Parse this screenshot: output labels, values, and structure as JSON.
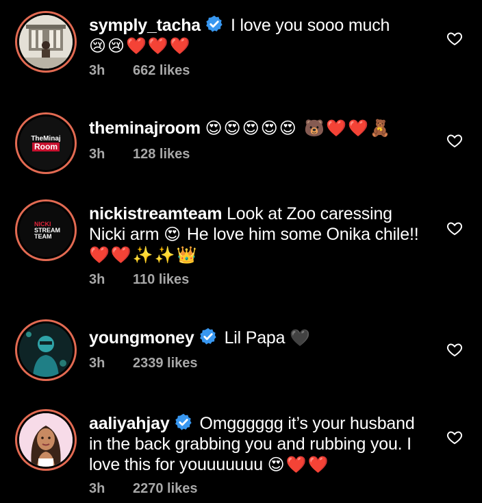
{
  "comments": [
    {
      "username": "symply_tacha",
      "verified": true,
      "text": "I love you sooo much",
      "emojis": "😢😢❤️❤️❤️",
      "time": "3h",
      "likes": "662 likes"
    },
    {
      "username": "theminajroom",
      "verified": false,
      "text": "",
      "emojis": "😍😍😍😍😍 🐻❤️❤️🧸",
      "time": "3h",
      "likes": "128 likes",
      "avatar_line1": "TheMinaj",
      "avatar_line2": "Room"
    },
    {
      "username": "nickistreamteam",
      "verified": false,
      "text_part1": "Look at Zoo caressing",
      "text_part2": "Nicki arm",
      "text_part3": "He love him some Onika chile!!",
      "emoji_inline": "😍",
      "emojis": "❤️❤️✨✨👑",
      "time": "3h",
      "likes": "110 likes",
      "avatar_line1": "NICKI",
      "avatar_line2": "STREAM",
      "avatar_line3": "TEAM"
    },
    {
      "username": "youngmoney",
      "verified": true,
      "text": "Lil Papa",
      "emojis": "🖤",
      "time": "3h",
      "likes": "2339 likes"
    },
    {
      "username": "aaliyahjay",
      "verified": true,
      "text_part1": "Omgggggg it’s your husband",
      "text_part2": "in the back grabbing you and rubbing you. I",
      "text_part3": "love this for youuuuuuu",
      "emojis": "😍❤️❤️",
      "time": "3h",
      "likes": "2270 likes"
    }
  ],
  "colors": {
    "background": "#000000",
    "verified_badge": "#3897f0",
    "meta_text": "#a8a8a8",
    "story_ring": "#e26a52"
  },
  "icons": {
    "like": "heart-outline-icon",
    "verified": "verified-badge-icon"
  }
}
